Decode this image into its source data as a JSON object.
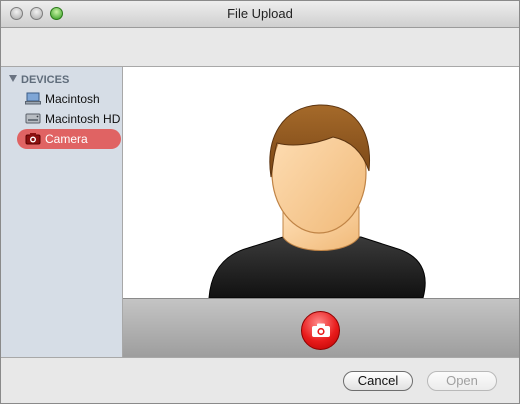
{
  "window": {
    "title": "File Upload"
  },
  "sidebar": {
    "section": "DEVICES",
    "items": [
      {
        "label": "Macintosh",
        "icon": "laptop-icon",
        "selected": false
      },
      {
        "label": "Macintosh HD",
        "icon": "hard-drive-icon",
        "selected": false
      },
      {
        "label": "Camera",
        "icon": "camera-icon",
        "selected": true
      }
    ]
  },
  "preview": {
    "icon": "person-avatar"
  },
  "capture": {
    "icon": "camera-icon",
    "color": "#e81b1b"
  },
  "footer": {
    "cancel_label": "Cancel",
    "open_label": "Open"
  }
}
